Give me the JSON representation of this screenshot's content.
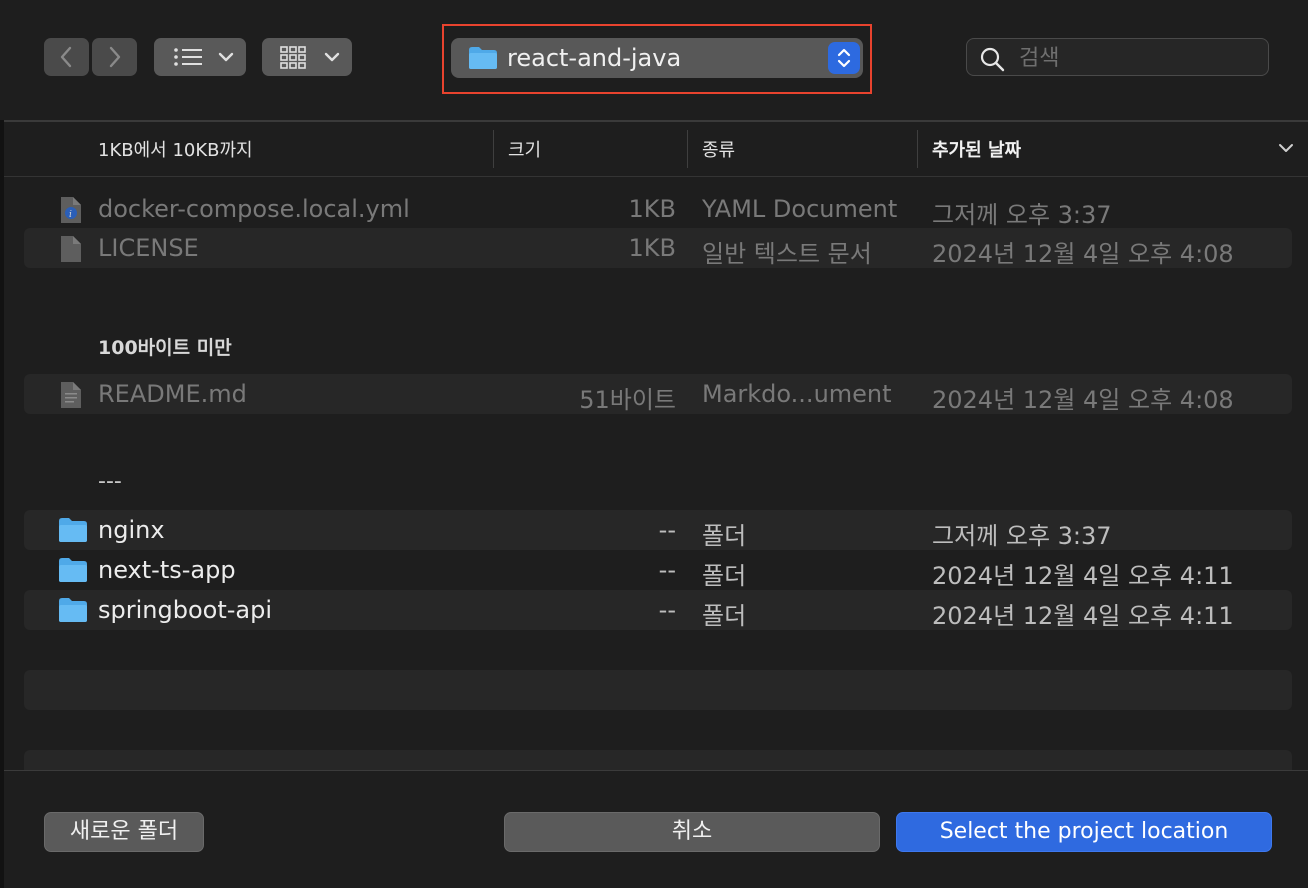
{
  "toolbar": {
    "current_folder": "react-and-java",
    "search_placeholder": "검색"
  },
  "columns": {
    "name": "1KB에서 10KB까지",
    "size": "크기",
    "kind": "종류",
    "date_added": "추가된 날짜"
  },
  "groups": {
    "small": {
      "rows": [
        {
          "name": "docker-compose.local.yml",
          "size": "1KB",
          "kind": "YAML Document",
          "date": "그저께 오후 3:37"
        },
        {
          "name": "LICENSE",
          "size": "1KB",
          "kind": "일반 텍스트 문서",
          "date": "2024년 12월 4일 오후 4:08"
        }
      ]
    },
    "tiny": {
      "title": "100바이트 미만",
      "rows": [
        {
          "name": "README.md",
          "size": "51바이트",
          "kind": "Markdo...ument",
          "date": "2024년 12월 4일 오후 4:08"
        }
      ]
    },
    "folders": {
      "title": "---",
      "rows": [
        {
          "name": "nginx",
          "size": "--",
          "kind": "폴더",
          "date": "그저께 오후 3:37"
        },
        {
          "name": "next-ts-app",
          "size": "--",
          "kind": "폴더",
          "date": "2024년 12월 4일 오후 4:11"
        },
        {
          "name": "springboot-api",
          "size": "--",
          "kind": "폴더",
          "date": "2024년 12월 4일 오후 4:11"
        }
      ]
    }
  },
  "footer": {
    "new_folder": "새로운 폴더",
    "cancel": "취소",
    "confirm": "Select the project location"
  },
  "colors": {
    "accent": "#2f6ae0",
    "highlight_border": "#e8432e",
    "folder": "#4fa9e8"
  }
}
